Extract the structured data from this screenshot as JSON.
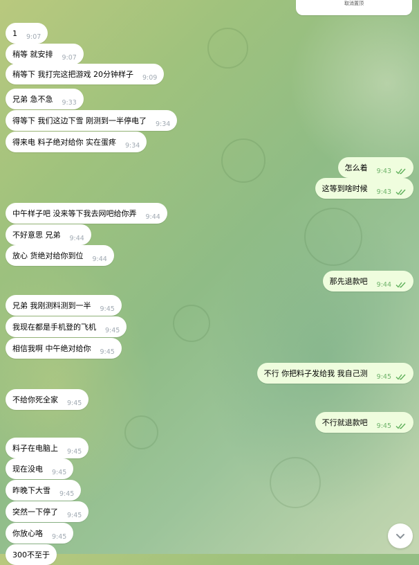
{
  "top_card": {
    "text": "取消置顶"
  },
  "messages": [
    {
      "dir": "in",
      "text": "1",
      "time": "9:07"
    },
    {
      "dir": "in",
      "text": "稍等  就安排",
      "time": "9:07"
    },
    {
      "dir": "in",
      "text": "稍等下  我打完这把游戏  20分钟样子",
      "time": "9:09"
    },
    {
      "dir": "in",
      "text": "兄弟  急不急",
      "time": "9:33"
    },
    {
      "dir": "in",
      "text": "得等下    我们这边下雪  刚测到一半停电了",
      "time": "9:34"
    },
    {
      "dir": "in",
      "text": "得来电    料子绝对给你    实在蛋疼",
      "time": "9:34"
    },
    {
      "dir": "out",
      "text": "怎么着",
      "time": "9:43"
    },
    {
      "dir": "out",
      "text": "这等到啥时候",
      "time": "9:43"
    },
    {
      "dir": "in",
      "text": "中午样子吧  没来等下我去网吧给你弄",
      "time": "9:44"
    },
    {
      "dir": "in",
      "text": "不好意思  兄弟",
      "time": "9:44"
    },
    {
      "dir": "in",
      "text": "放心    货绝对给你到位",
      "time": "9:44"
    },
    {
      "dir": "out",
      "text": "那先退款吧",
      "time": "9:44"
    },
    {
      "dir": "in",
      "text": "兄弟    我刚测料测到一半",
      "time": "9:45"
    },
    {
      "dir": "in",
      "text": "我现在都是手机登的飞机",
      "time": "9:45"
    },
    {
      "dir": "in",
      "text": "相信我啊  中午绝对给你",
      "time": "9:45"
    },
    {
      "dir": "out",
      "text": "不行 你把料子发给我  我自己测",
      "time": "9:45"
    },
    {
      "dir": "in",
      "text": "不给你死全家",
      "time": "9:45"
    },
    {
      "dir": "out",
      "text": "不行就退款吧",
      "time": "9:45"
    },
    {
      "dir": "in",
      "text": "料子在电脑上",
      "time": "9:45"
    },
    {
      "dir": "in",
      "text": "现在没电",
      "time": "9:45"
    },
    {
      "dir": "in",
      "text": "昨晚下大雪",
      "time": "9:45"
    },
    {
      "dir": "in",
      "text": "突然一下停了",
      "time": "9:45"
    },
    {
      "dir": "in",
      "text": "你放心咯",
      "time": "9:45"
    },
    {
      "dir": "in",
      "text": "300不至于",
      "time": ""
    }
  ],
  "icons": {
    "read_receipt": "double-check-icon",
    "scroll_down": "chevron-down-icon"
  },
  "colors": {
    "incoming_bubble": "#ffffff",
    "outgoing_bubble": "#effdde",
    "read_check": "#5fb05a"
  }
}
